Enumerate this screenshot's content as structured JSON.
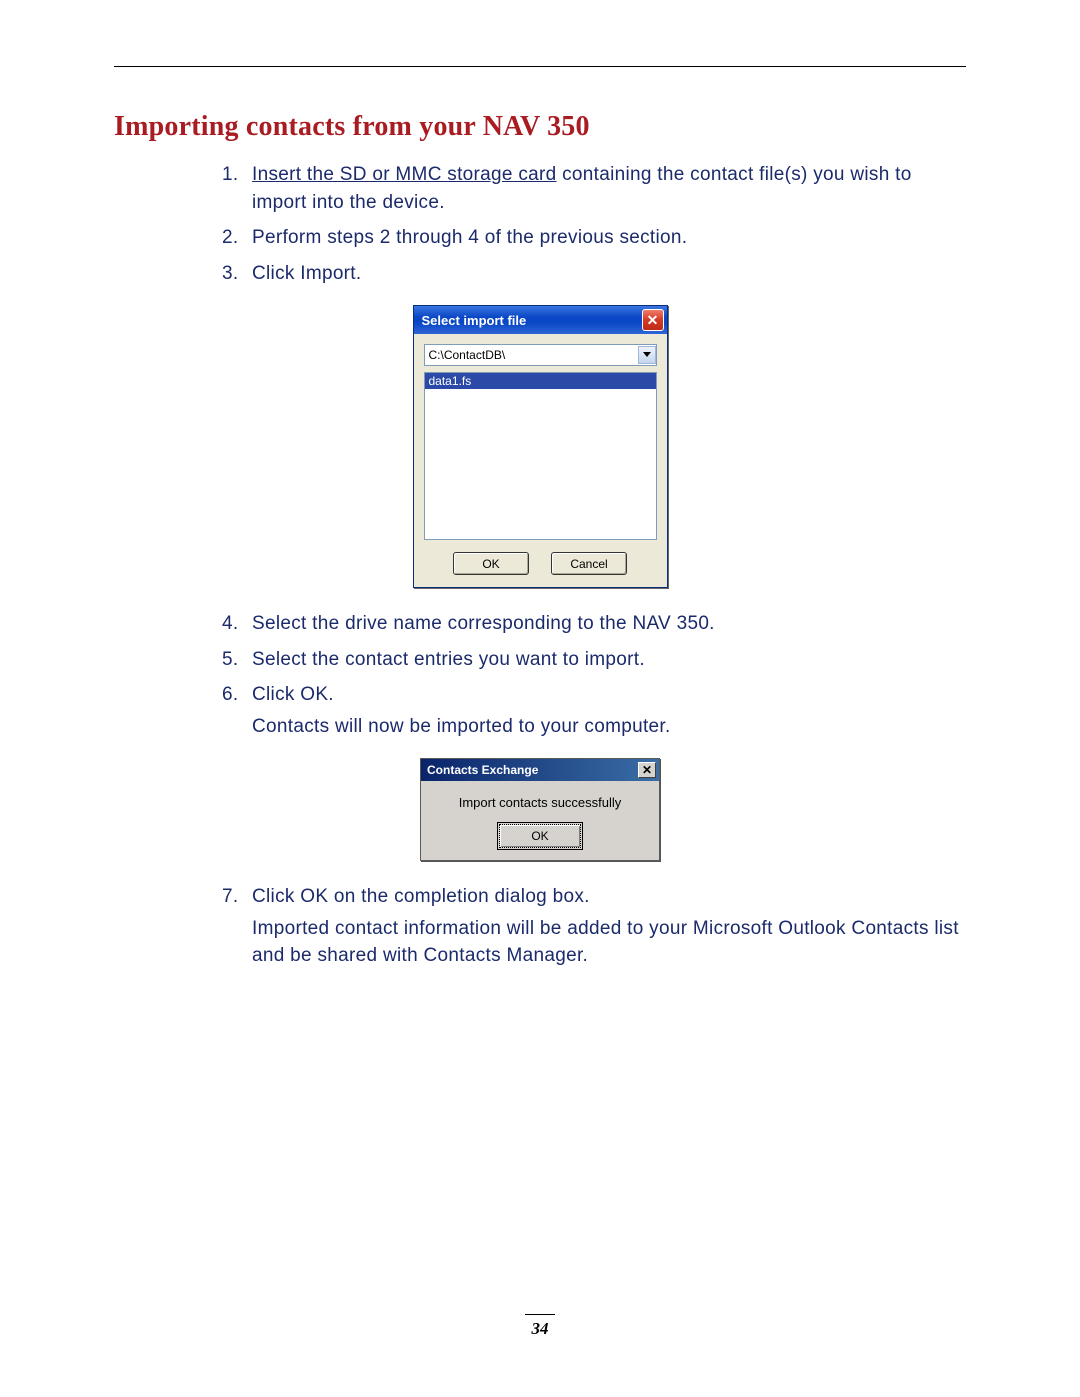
{
  "heading": "Importing contacts from your NAV 350",
  "steps": {
    "s1_link": "Insert the SD or MMC storage card",
    "s1_rest": " containing the contact file(s) you wish to import into the device.",
    "s2": "Perform steps 2 through 4 of the previous section.",
    "s3": "Click Import.",
    "s4": "Select the drive name corresponding to the NAV 350.",
    "s5": "Select the contact entries you want to import.",
    "s6": "Click OK.",
    "s6_extra": "Contacts will now be imported to your computer.",
    "s7": "Click OK on the completion dialog box.",
    "s7_extra": "Imported contact information will be added to your Microsoft Outlook Contacts list and be shared with Contacts Manager."
  },
  "dialog1": {
    "title": "Select import file",
    "close_glyph": "✕",
    "path": "C:\\ContactDB\\",
    "list_item": "data1.fs",
    "ok": "OK",
    "cancel": "Cancel"
  },
  "dialog2": {
    "title": "Contacts Exchange",
    "close_glyph": "✕",
    "message": "Import contacts successfully",
    "ok": "OK"
  },
  "page_number": "34"
}
